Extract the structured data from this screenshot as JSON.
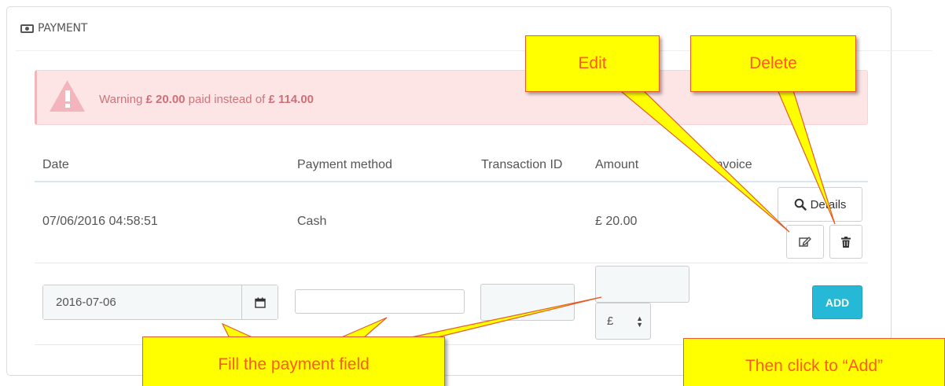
{
  "panel": {
    "title": "PAYMENT",
    "icon": "money-icon"
  },
  "alert": {
    "prefix": "Warning ",
    "paid": "£ 20.00",
    "middle": " paid instead of ",
    "due": "£ 114.00",
    "icon": "warning-icon"
  },
  "table": {
    "headers": [
      "Date",
      "Payment method",
      "Transaction ID",
      "Amount",
      "Invoice"
    ],
    "rows": [
      {
        "date": "07/06/2016 04:58:51",
        "method": "Cash",
        "transaction_id": "",
        "amount": "£ 20.00"
      }
    ],
    "details_label": "Details"
  },
  "form": {
    "date_value": "2016-07-06",
    "method_value": "",
    "transaction_value": "",
    "amount_value": "",
    "currency": "£",
    "add_label": "ADD"
  },
  "callouts": {
    "edit": "Edit",
    "delete": "Delete",
    "fill": "Fill the payment field",
    "add": "Then click to “Add”"
  },
  "colors": {
    "alert_bg": "#fde5e6",
    "alert_text": "#d0737b",
    "add_button": "#25b9d7",
    "callout_fill": "#ffff00",
    "callout_text": "#ff5a1f"
  }
}
